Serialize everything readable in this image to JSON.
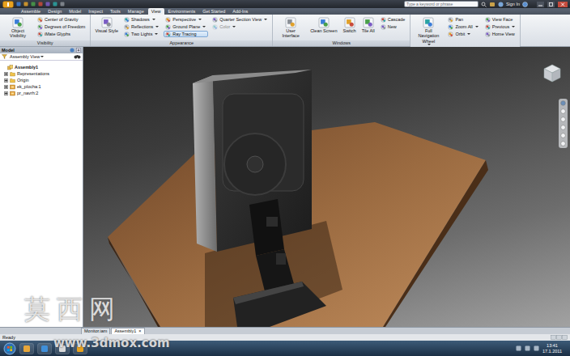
{
  "menu_tabs": [
    {
      "label": "Assemble",
      "selected": false
    },
    {
      "label": "Design",
      "selected": false
    },
    {
      "label": "Model",
      "selected": false
    },
    {
      "label": "Inspect",
      "selected": false
    },
    {
      "label": "Tools",
      "selected": false
    },
    {
      "label": "Manage",
      "selected": false
    },
    {
      "label": "View",
      "selected": true
    },
    {
      "label": "Environments",
      "selected": false
    },
    {
      "label": "Get Started",
      "selected": false
    },
    {
      "label": "Add-Ins",
      "selected": false
    }
  ],
  "search": {
    "placeholder": "Type a keyword or phrase"
  },
  "sign_in": "Sign In",
  "ribbon_groups": [
    {
      "label": "Visibility",
      "columns": [
        {
          "kind": "large",
          "items": [
            {
              "label": "Object Visibility",
              "selected": false,
              "disabled": false,
              "has_menu": false
            }
          ]
        },
        {
          "kind": "small",
          "items": [
            {
              "label": "Center of Gravity",
              "selected": false,
              "disabled": false,
              "has_menu": false
            },
            {
              "label": "Degrees of Freedom",
              "selected": false,
              "disabled": false,
              "has_menu": false
            },
            {
              "label": "iMate Glyphs",
              "selected": false,
              "disabled": false,
              "has_menu": false
            }
          ]
        }
      ]
    },
    {
      "label": "Appearance",
      "columns": [
        {
          "kind": "large",
          "items": [
            {
              "label": "Visual Style",
              "selected": false,
              "disabled": false,
              "has_menu": false
            }
          ]
        },
        {
          "kind": "small",
          "items": [
            {
              "label": "Shadows",
              "selected": false,
              "disabled": false,
              "has_menu": true
            },
            {
              "label": "Reflections",
              "selected": false,
              "disabled": false,
              "has_menu": true
            },
            {
              "label": "Two Lights",
              "selected": false,
              "disabled": false,
              "has_menu": true
            }
          ]
        },
        {
          "kind": "small",
          "items": [
            {
              "label": "Perspective",
              "selected": false,
              "disabled": false,
              "has_menu": true
            },
            {
              "label": "Ground Plane",
              "selected": false,
              "disabled": false,
              "has_menu": true
            },
            {
              "label": "Ray Tracing",
              "selected": true,
              "disabled": false,
              "has_menu": false
            }
          ]
        },
        {
          "kind": "small",
          "items": [
            {
              "label": "Quarter Section View",
              "selected": false,
              "disabled": false,
              "has_menu": true
            },
            {
              "label": "Color",
              "selected": false,
              "disabled": true,
              "has_menu": true
            }
          ]
        }
      ]
    },
    {
      "label": "Windows",
      "columns": [
        {
          "kind": "large",
          "items": [
            {
              "label": "User Interface",
              "selected": false,
              "disabled": false,
              "has_menu": false
            }
          ]
        },
        {
          "kind": "large",
          "items": [
            {
              "label": "Clean Screen",
              "selected": false,
              "disabled": false,
              "has_menu": false
            }
          ]
        },
        {
          "kind": "large",
          "items": [
            {
              "label": "Switch",
              "selected": false,
              "disabled": false,
              "has_menu": false
            }
          ]
        },
        {
          "kind": "large",
          "items": [
            {
              "label": "Tile All",
              "selected": false,
              "disabled": false,
              "has_menu": false
            }
          ]
        },
        {
          "kind": "small",
          "items": [
            {
              "label": "Cascade",
              "selected": false,
              "disabled": false,
              "has_menu": false
            },
            {
              "label": "New",
              "selected": false,
              "disabled": false,
              "has_menu": false
            }
          ]
        }
      ]
    },
    {
      "label": "Navigate",
      "columns": [
        {
          "kind": "large",
          "items": [
            {
              "label": "Full Navigation Wheel",
              "selected": false,
              "disabled": false,
              "has_menu": true
            }
          ]
        },
        {
          "kind": "small",
          "items": [
            {
              "label": "Pan",
              "selected": false,
              "disabled": false,
              "has_menu": false
            },
            {
              "label": "Zoom All",
              "selected": false,
              "disabled": false,
              "has_menu": true
            },
            {
              "label": "Orbit",
              "selected": false,
              "disabled": false,
              "has_menu": true
            }
          ]
        },
        {
          "kind": "small",
          "items": [
            {
              "label": "View Face",
              "selected": false,
              "disabled": false,
              "has_menu": false
            },
            {
              "label": "Previous",
              "selected": false,
              "disabled": false,
              "has_menu": true
            },
            {
              "label": "Home View",
              "selected": false,
              "disabled": false,
              "has_menu": false
            }
          ]
        }
      ]
    }
  ],
  "browser": {
    "title": "Model",
    "view": "Assembly View",
    "tree": [
      {
        "label": "Assembly1",
        "depth": 0,
        "kind": "assembly",
        "expandable": false,
        "expanded": true
      },
      {
        "label": "Representations",
        "depth": 1,
        "kind": "folder",
        "expandable": true,
        "expanded": false
      },
      {
        "label": "Origin",
        "depth": 1,
        "kind": "folder",
        "expandable": true,
        "expanded": false
      },
      {
        "label": "ek_plocha:1",
        "depth": 1,
        "kind": "part",
        "expandable": true,
        "expanded": false
      },
      {
        "label": "pr_navrh:2",
        "depth": 1,
        "kind": "part",
        "expandable": true,
        "expanded": false
      }
    ]
  },
  "document_tabs": [
    {
      "label": "Monitor.iam",
      "selected": false,
      "close": null
    },
    {
      "label": "Assembly1",
      "selected": true,
      "close": "×"
    }
  ],
  "status_bar": {
    "text": "Ready"
  },
  "clock": {
    "time": "13:41",
    "date": "17.1.2011"
  },
  "watermark": {
    "brand": "莫西网",
    "url": "www.3dmox.com"
  }
}
